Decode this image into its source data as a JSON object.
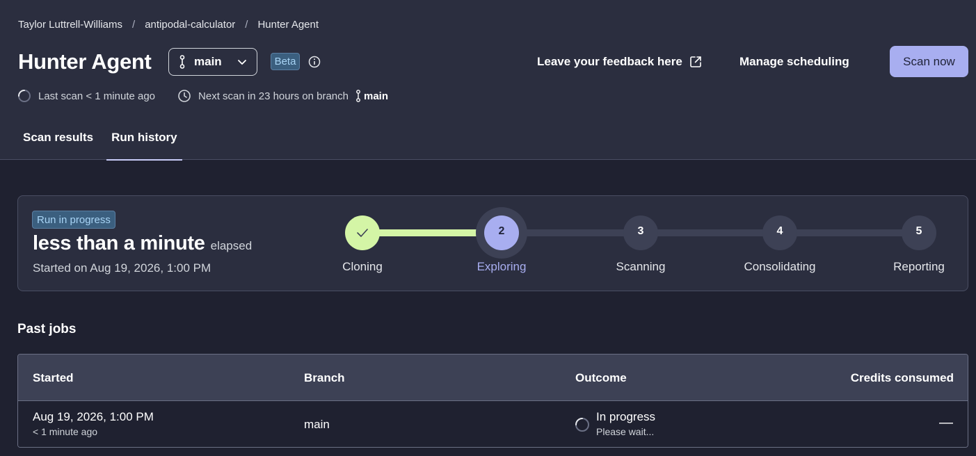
{
  "breadcrumb": {
    "items": [
      "Taylor Luttrell-Williams",
      "antipodal-calculator",
      "Hunter Agent"
    ],
    "separator": "/"
  },
  "header": {
    "title": "Hunter Agent",
    "branch_selector": {
      "value": "main",
      "icon": "git-branch-icon"
    },
    "beta_label": "Beta",
    "feedback_label": "Leave your feedback here",
    "manage_scheduling_label": "Manage scheduling",
    "scan_now_label": "Scan now"
  },
  "meta": {
    "last_scan": "Last scan < 1 minute ago",
    "next_scan": "Next scan in 23 hours on branch",
    "next_scan_branch": "main"
  },
  "tabs": [
    {
      "label": "Scan results",
      "active": false
    },
    {
      "label": "Run history",
      "active": true
    }
  ],
  "run": {
    "status_badge": "Run in progress",
    "elapsed_value": "less than a minute",
    "elapsed_unit": "elapsed",
    "started_on": "Started on Aug 19, 2026, 1:00 PM",
    "steps": [
      {
        "number": "",
        "label": "Cloning",
        "state": "done"
      },
      {
        "number": "2",
        "label": "Exploring",
        "state": "current"
      },
      {
        "number": "3",
        "label": "Scanning",
        "state": "pending"
      },
      {
        "number": "4",
        "label": "Consolidating",
        "state": "pending"
      },
      {
        "number": "5",
        "label": "Reporting",
        "state": "pending"
      }
    ]
  },
  "past_jobs": {
    "title": "Past jobs",
    "columns": [
      "Started",
      "Branch",
      "Outcome",
      "Credits consumed"
    ],
    "rows": [
      {
        "started": "Aug 19, 2026, 1:00 PM",
        "started_relative": "< 1 minute ago",
        "branch": "main",
        "outcome": "In progress",
        "outcome_detail": "Please wait...",
        "credits": "—"
      }
    ]
  },
  "colors": {
    "accent": "#a8aef0",
    "done_step": "#d4f5a6",
    "badge_bg": "#3b5f7f",
    "badge_text": "#a8d4f5",
    "header_bg": "#2b2e3f",
    "page_bg": "#1f2130"
  }
}
